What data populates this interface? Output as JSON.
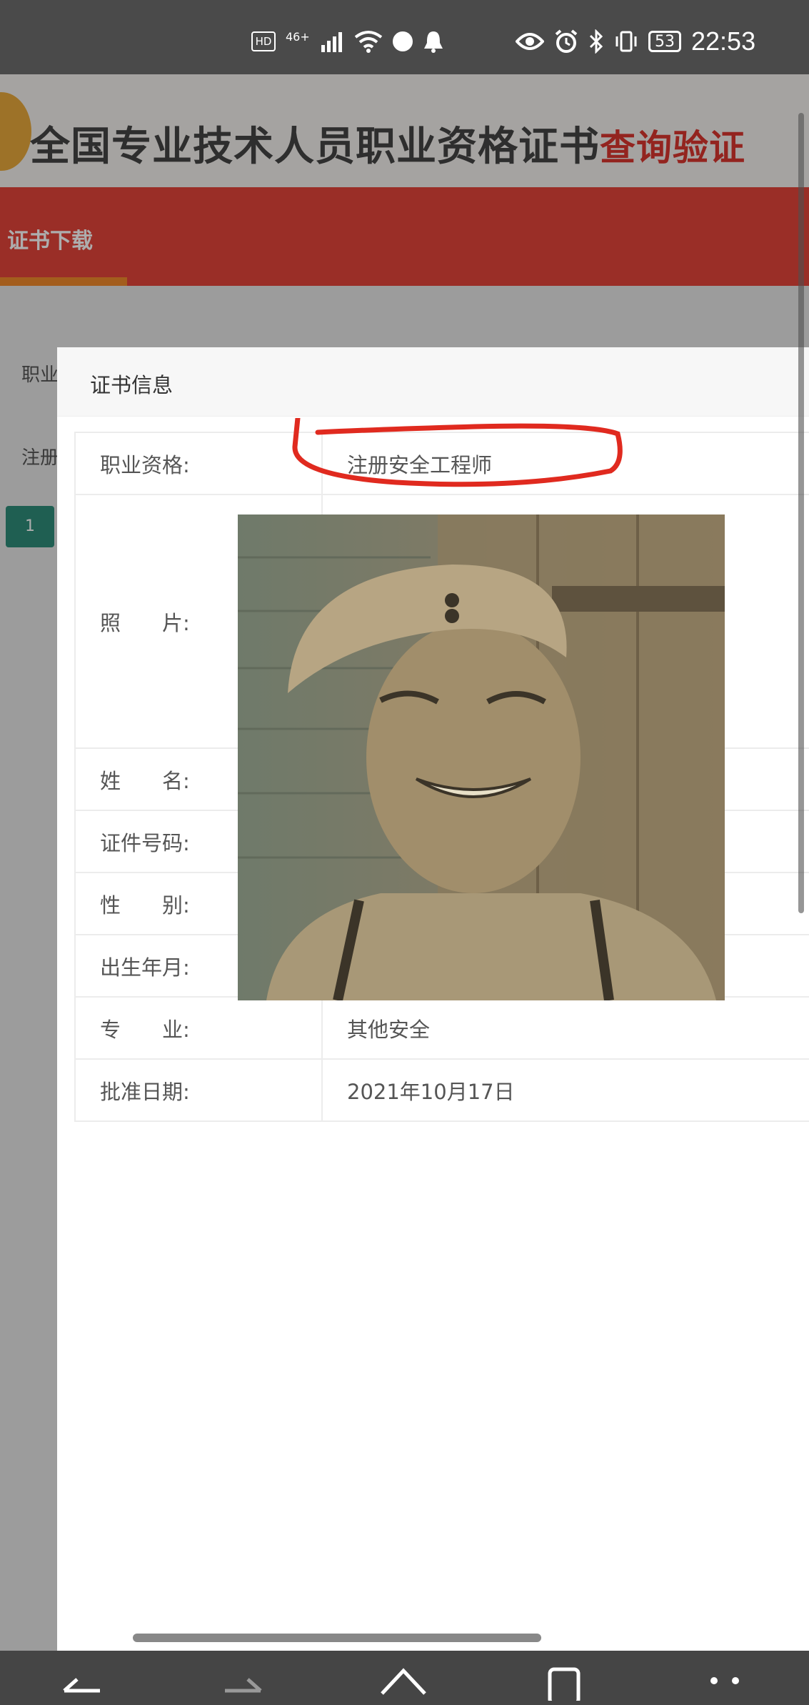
{
  "status_bar": {
    "network_hd": "HD",
    "network_type": "46+",
    "battery": "53",
    "time": "22:53"
  },
  "site": {
    "title_main": "全国专业技术人员职业资格证书",
    "title_accent": "查询验证",
    "nav_tab": "证书下载",
    "bg_col_label": "职业",
    "bg_row_label": "注册",
    "bg_page_number": "1"
  },
  "dialog": {
    "title": "证书信息",
    "rows": [
      {
        "label": "职业资格:",
        "value": "注册安全工程师"
      },
      {
        "label": "照　　片:",
        "value": ""
      },
      {
        "label": "姓　　名:",
        "value": ""
      },
      {
        "label": "证件号码:",
        "value": ""
      },
      {
        "label": "性　　别:",
        "value": ""
      },
      {
        "label": "出生年月:",
        "value": ""
      },
      {
        "label": "专　　业:",
        "value": "其他安全"
      },
      {
        "label": "批准日期:",
        "value": "2021年10月17日"
      }
    ]
  },
  "colors": {
    "nav_red": "#e4443a",
    "accent_red": "#d9362f",
    "annotation_red": "#e02a1f",
    "page_button": "#2f8c7a"
  },
  "icons": [
    "signal-icon",
    "wifi-icon",
    "app-icon",
    "notification-icon",
    "eye-icon",
    "alarm-icon",
    "bluetooth-icon",
    "vibrate-icon",
    "back-icon",
    "forward-icon",
    "home-icon",
    "tabs-icon",
    "menu-icon"
  ]
}
